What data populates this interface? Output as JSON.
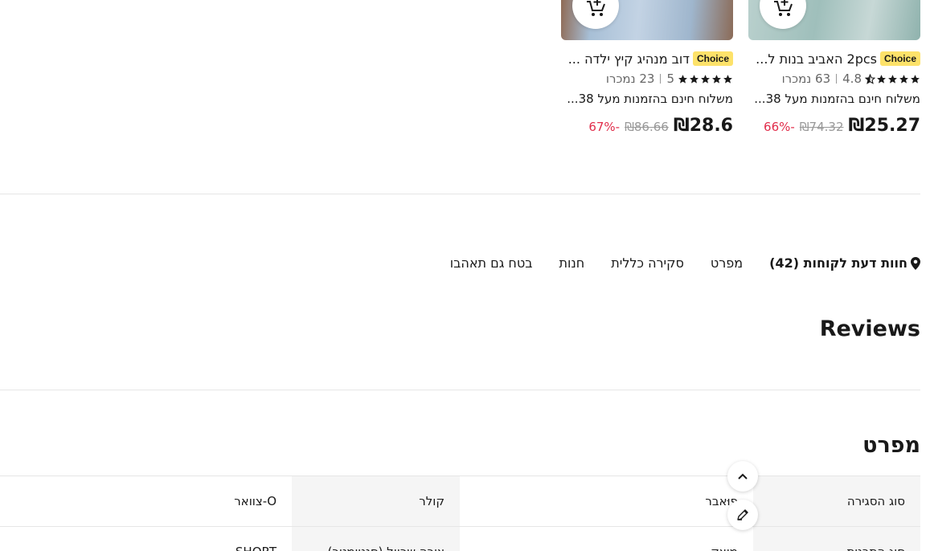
{
  "recommended_products": [
    {
      "badge": "Choice",
      "title": "2pcs האביב בנות ל...",
      "rating": "4.8",
      "sold": "63 נמכרו",
      "shipping": "משלוח חינם בהזמנות מעל 38...",
      "price": "₪25.27",
      "old_price": "₪74.32",
      "discount": "-66%",
      "image_color": "#a9c7c3"
    },
    {
      "badge": "Choice",
      "title": "דוב מנהיג קיץ ילדה ...",
      "rating": "5",
      "sold": "23 נמכרו",
      "shipping": "משלוח חינם בהזמנות מעל 38...",
      "price": "₪28.6",
      "old_price": "₪86.66",
      "discount": "-67%",
      "image_color": "#9db6cf"
    }
  ],
  "tabs": [
    {
      "label": "חוות דעת לקוחות (42)",
      "icon": "location-pin-icon",
      "active": true
    },
    {
      "label": "מפרט"
    },
    {
      "label": "סקירה כללית"
    },
    {
      "label": "חנות"
    },
    {
      "label": "בטח גם תאהבו"
    }
  ],
  "reviews_heading": "Reviews",
  "spec_heading": "מפרט",
  "spec_rows": [
    {
      "k1": "סוג הסגירה",
      "v1": "פוּאבר",
      "k2": "קולר",
      "v2": "O-צוואר"
    },
    {
      "k1": "סוג התבנית",
      "v1": "מוצק",
      "k2": "צורה שרוול (סנטימטר)",
      "v2": "SHORT"
    }
  ],
  "colors": {
    "discount": "#e12d4b",
    "badge": "#fde26a",
    "table_key_bg": "#f5f5f5"
  },
  "floating_buttons": [
    "chevron-up-icon",
    "edit-pencil-icon"
  ]
}
